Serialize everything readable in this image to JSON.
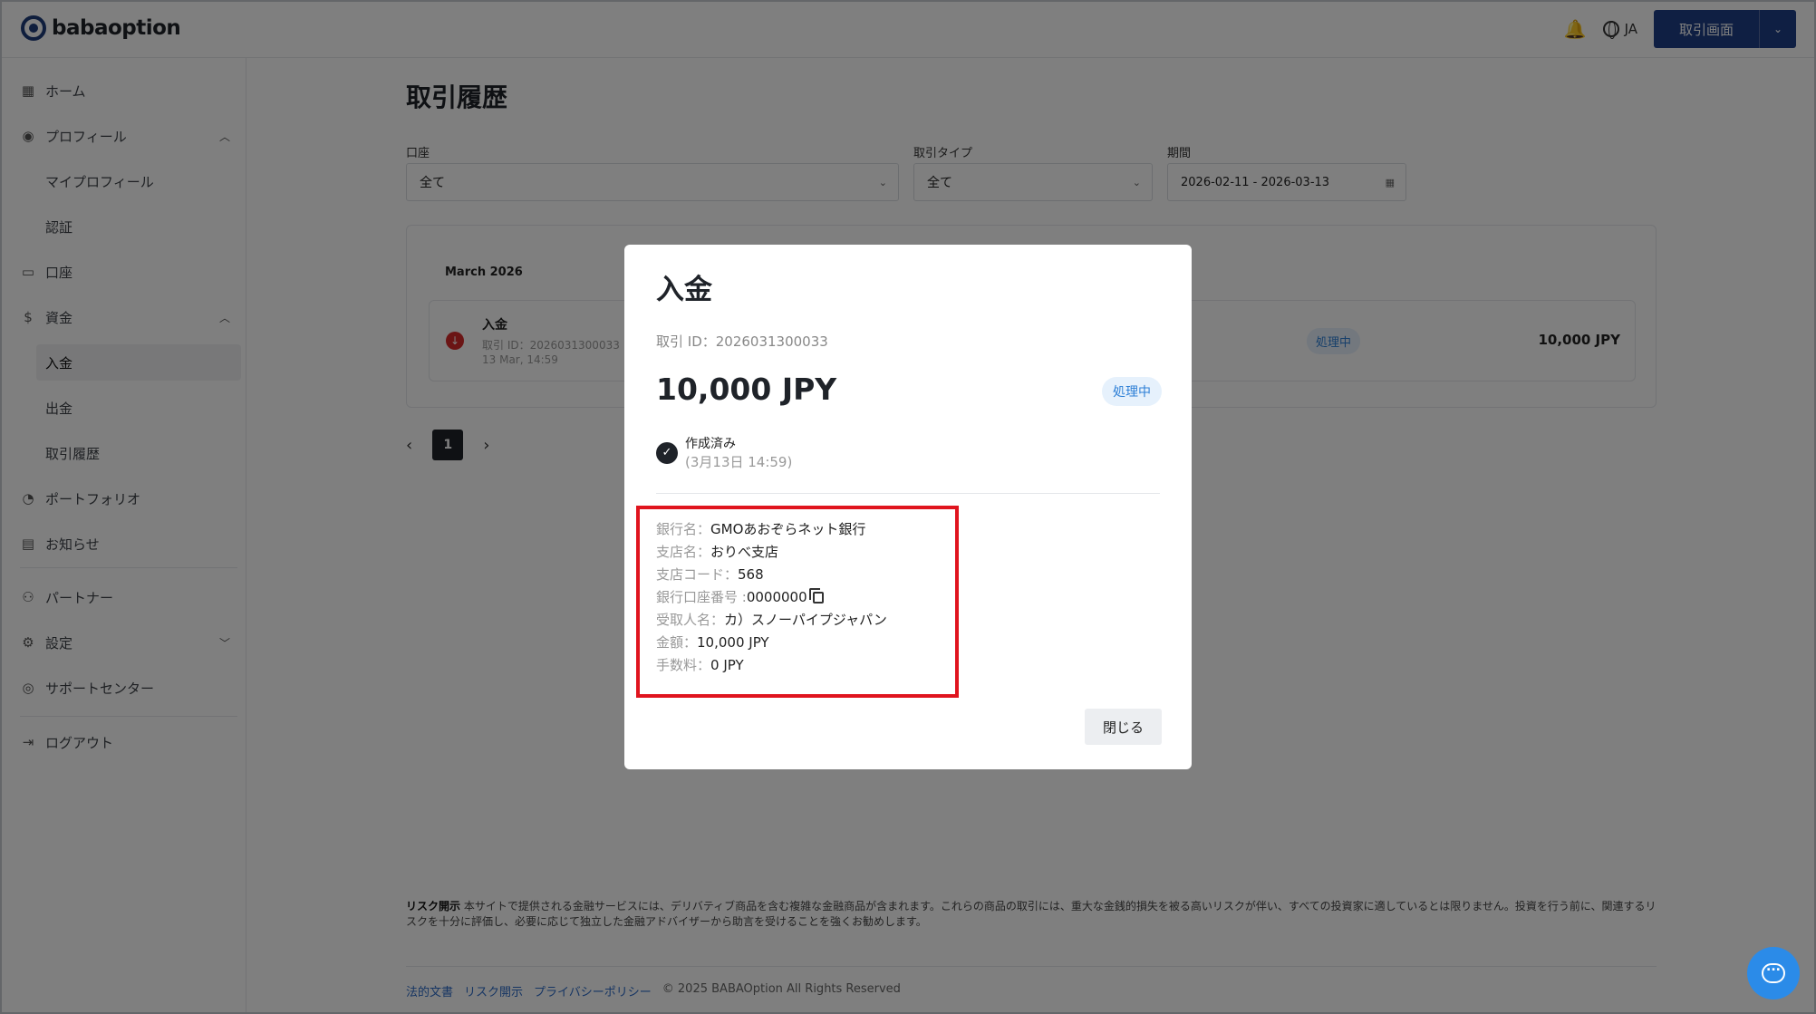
{
  "header": {
    "logo_text": "babaoption",
    "lang": "JA",
    "trade_button": "取引画面"
  },
  "sidebar": {
    "items": [
      {
        "label": "ホーム",
        "icon": "grid-icon"
      },
      {
        "label": "プロフィール",
        "icon": "user-circle-icon"
      },
      {
        "label": "マイプロフィール"
      },
      {
        "label": "認証"
      },
      {
        "label": "口座",
        "icon": "wallet-icon"
      },
      {
        "label": "資金",
        "icon": "dollar-icon"
      },
      {
        "label": "入金"
      },
      {
        "label": "出金"
      },
      {
        "label": "取引履歴"
      },
      {
        "label": "ポートフォリオ",
        "icon": "pie-icon"
      },
      {
        "label": "お知らせ",
        "icon": "message-icon"
      },
      {
        "label": "パートナー",
        "icon": "partner-icon"
      },
      {
        "label": "設定",
        "icon": "gear-icon"
      },
      {
        "label": "サポートセンター",
        "icon": "support-icon"
      },
      {
        "label": "ログアウト",
        "icon": "logout-icon"
      }
    ]
  },
  "main": {
    "title": "取引履歴",
    "filters": {
      "account_label": "口座",
      "account_value": "全て",
      "type_label": "取引タイプ",
      "type_value": "全て",
      "period_label": "期間",
      "period_value": "2026-02-11 - 2026-03-13"
    },
    "month": "March 2026",
    "transaction": {
      "title": "入金",
      "id": "取引 ID：2026031300033",
      "date": "13 Mar, 14:59",
      "status": "処理中",
      "amount": "10,000 JPY"
    },
    "page": "1",
    "risk_title": "リスク開示",
    "risk_text": "本サイトで提供される金融サービスには、デリバティブ商品を含む複雑な金融商品が含まれます。これらの商品の取引には、重大な金銭的損失を被る高いリスクが伴い、すべての投資家に適しているとは限りません。投資を行う前に、関連するリスクを十分に評価し、必要に応じて独立した金融アドバイザーから助言を受けることを強くお勧めします。",
    "footer": {
      "legal": "法的文書",
      "risk": "リスク開示",
      "privacy": "プライバシーポリシー",
      "copyright": "© 2025 BABAOption All Rights Reserved"
    }
  },
  "modal": {
    "title": "入金",
    "tx_id": "取引 ID：2026031300033",
    "amount": "10,000 JPY",
    "status": "処理中",
    "step_label": "作成済み",
    "step_time": "(3月13日 14:59)",
    "details": [
      {
        "k": "銀行名：",
        "v": "GMOあおぞらネット銀行"
      },
      {
        "k": "支店名：",
        "v": "おりべ支店"
      },
      {
        "k": "支店コード：",
        "v": "568"
      },
      {
        "k": "銀行口座番号 :",
        "v": "0000000"
      },
      {
        "k": "受取人名：",
        "v": "カ）スノーパイプジャパン"
      },
      {
        "k": "金額：",
        "v": "10,000 JPY"
      },
      {
        "k": "手数料：",
        "v": "0 JPY"
      }
    ],
    "close": "閉じる"
  },
  "colors": {
    "brand": "#1e3f86",
    "status_blue": "#2d7fd6",
    "highlight_red": "#e0141e",
    "deposit_red": "#d62b2b"
  }
}
